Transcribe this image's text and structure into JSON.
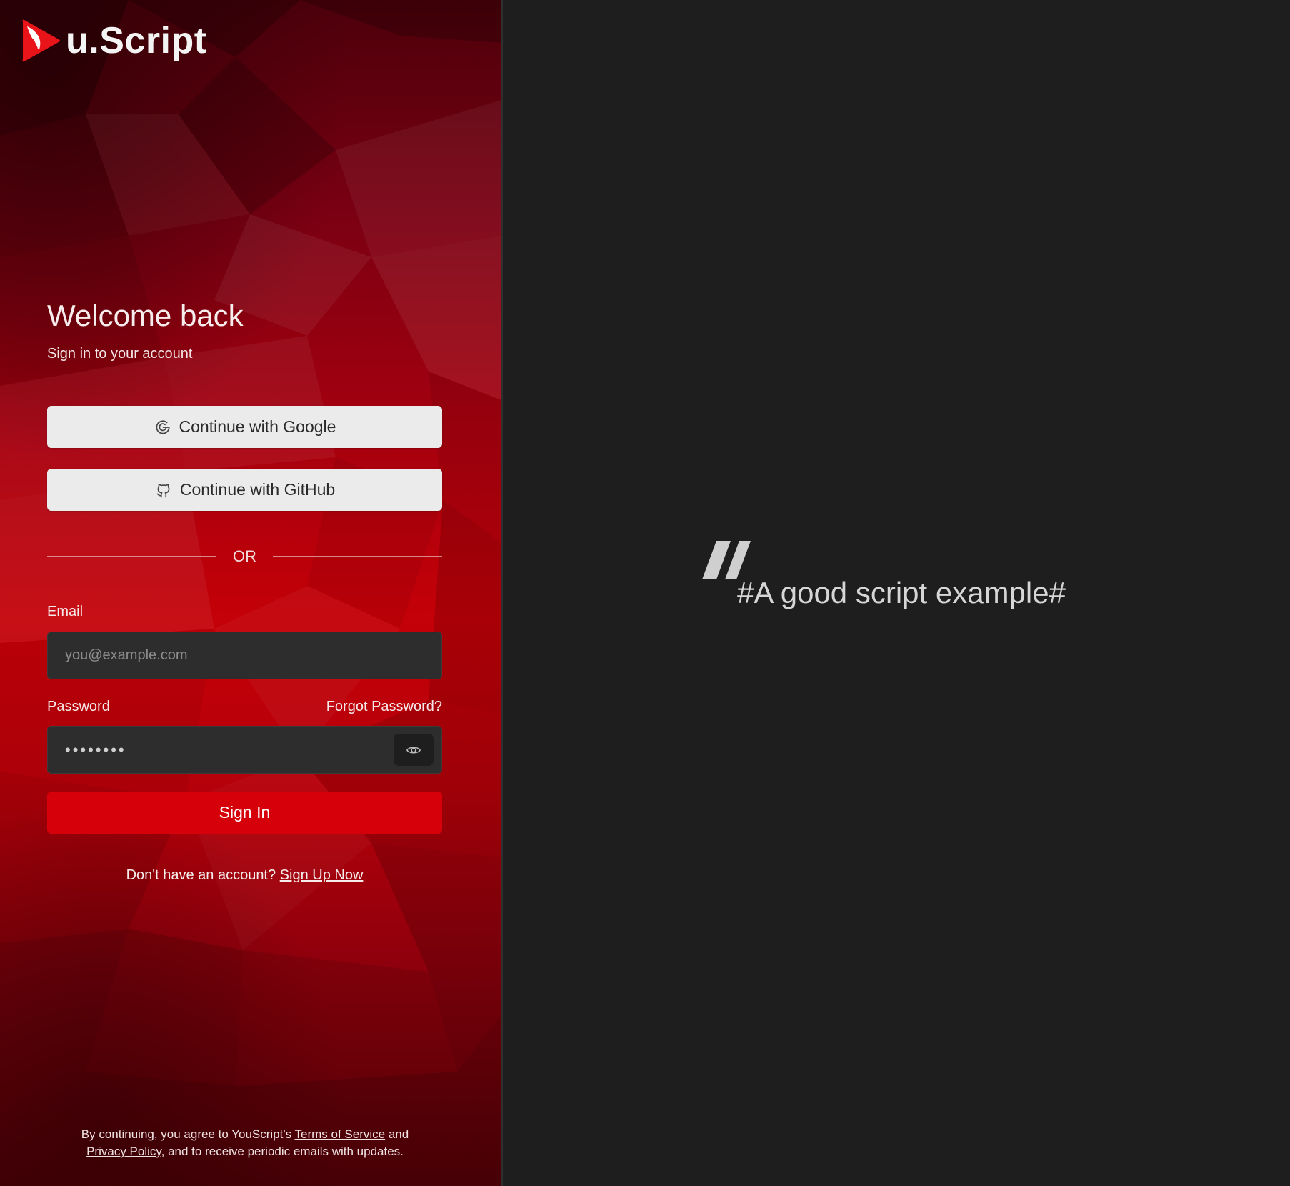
{
  "brand": {
    "logo_text": "u.Script",
    "logo_color": "#e8141a"
  },
  "login": {
    "title": "Welcome back",
    "subtitle": "Sign in to your account",
    "google_button": "Continue with Google",
    "github_button": "Continue with GitHub",
    "separator": "OR",
    "email_label": "Email",
    "email_placeholder": "you@example.com",
    "email_value": "",
    "password_label": "Password",
    "forgot_password": "Forgot Password?",
    "password_value": "••••••••",
    "password_toggle_icon": "eye-icon",
    "signin_button": "Sign In",
    "no_account_text": "Don't have an account? ",
    "signup_link": "Sign Up Now"
  },
  "legal": {
    "part1": "By continuing, you agree to YouScript's ",
    "terms_link": "Terms of Service",
    "part2": " and",
    "privacy_link": "Privacy Policy",
    "part3": ", and to receive periodic emails with updates."
  },
  "quote": {
    "icon": "quote-icon",
    "text": "#A good script example#"
  },
  "colors": {
    "primary": "#d50009",
    "right_background": "#1e1e1e",
    "input_background": "#2d2d2d",
    "oauth_button_background": "#ebebeb"
  }
}
